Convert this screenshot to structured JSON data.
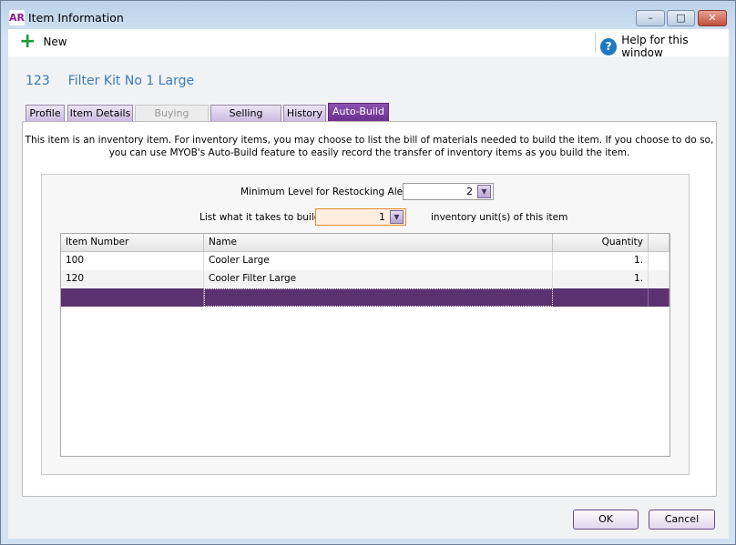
{
  "window": {
    "logo": "AR",
    "title": "Item Information",
    "controls": [
      "minimize",
      "maximize",
      "close"
    ]
  },
  "toolbar": {
    "new_label": "New",
    "help_label": "Help for this window"
  },
  "item": {
    "number": "123",
    "name": "Filter Kit No 1 Large"
  },
  "tabs": [
    {
      "label": "Profile",
      "state": "normal"
    },
    {
      "label": "Item Details",
      "state": "normal"
    },
    {
      "label": "Buying Details",
      "state": "disabled"
    },
    {
      "label": "Selling Details",
      "state": "normal"
    },
    {
      "label": "History",
      "state": "normal"
    },
    {
      "label": "Auto-Build",
      "state": "active"
    }
  ],
  "autobuild": {
    "info_line1": "This item is an inventory item. For inventory items, you may choose to list the bill of materials needed to build the item. If you choose to do so,",
    "info_line2": "you can use MYOB's Auto-Build feature to easily record the transfer of inventory items as you build the item.",
    "restock_label": "Minimum Level for Restocking Alert:",
    "restock_value": "2",
    "build_label": "List what it takes to build",
    "build_value": "1",
    "build_suffix": "inventory unit(s) of this item",
    "columns": [
      "Item Number",
      "Name",
      "Quantity"
    ],
    "rows": [
      {
        "item_number": "100",
        "name": "Cooler Large",
        "quantity": "1."
      },
      {
        "item_number": "120",
        "name": "Cooler Filter Large",
        "quantity": "1."
      }
    ]
  },
  "buttons": {
    "ok": "OK",
    "cancel": "Cancel"
  },
  "colors": {
    "accent": "#5c3170",
    "title_text": "#3c7ab8",
    "focus": "#e68a2e"
  }
}
